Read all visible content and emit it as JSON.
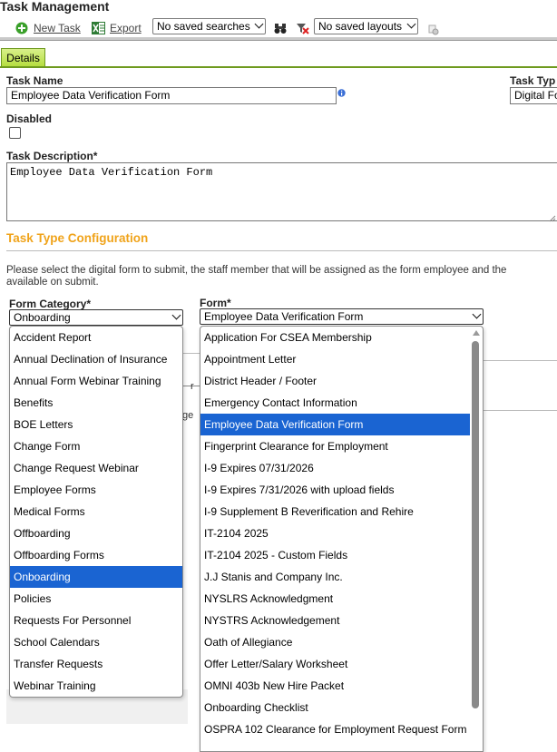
{
  "app": {
    "title": "Task Management"
  },
  "toolbar": {
    "new_task": "New Task",
    "export": "Export",
    "saved_searches": "No saved searches",
    "saved_layouts": "No saved layouts"
  },
  "tabs": [
    {
      "label": "Details"
    }
  ],
  "fields": {
    "task_name_label": "Task Name",
    "task_name_value": "Employee Data Verification Form",
    "task_type_label": "Task Typ",
    "task_type_value": "Digital Fo",
    "disabled_label": "Disabled",
    "description_label": "Task Description*",
    "description_value": "Employee Data Verification Form"
  },
  "config": {
    "title": "Task Type Configuration",
    "instructions_line1": "Please select the digital form to submit, the staff member that will be assigned as the form employee and the",
    "instructions_line2": "available on submit.",
    "form_category_label": "Form Category*",
    "form_category_value": "Onboarding",
    "form_label": "Form*",
    "form_value": "Employee Data Verification Form"
  },
  "background_fragments": {
    "r": "r",
    "ge": "ge"
  },
  "category_options": [
    "Accident Report",
    "Annual Declination of Insurance",
    "Annual Form Webinar Training",
    "Benefits",
    "BOE Letters",
    "Change Form",
    "Change Request Webinar",
    "Employee Forms",
    "Medical Forms",
    "Offboarding",
    "Offboarding Forms",
    "Onboarding",
    "Policies",
    "Requests For Personnel",
    "School Calendars",
    "Transfer Requests",
    "Webinar Training"
  ],
  "category_selected": "Onboarding",
  "form_options": [
    "Application For CSEA Membership",
    "Appointment Letter",
    "District Header / Footer",
    "Emergency Contact Information",
    "Employee Data Verification Form",
    "Fingerprint Clearance for Employment",
    "I-9 Expires 07/31/2026",
    "I-9 Expires 7/31/2026 with upload fields",
    "I-9 Supplement B Reverification and Rehire",
    "IT-2104 2025",
    "IT-2104 2025 - Custom Fields",
    "J.J Stanis and Company Inc.",
    "NYSLRS Acknowledgment",
    "NYSTRS Acknowledgement",
    "Oath of Allegiance",
    "Offer Letter/Salary Worksheet",
    "OMNI 403b New Hire Packet",
    "Onboarding Checklist",
    "OSPRA 102 Clearance for Employment Request Form"
  ],
  "form_selected": "Employee Data Verification Form",
  "colors": {
    "accent": "#f0a31a",
    "selection": "#1a64d2",
    "tab": "#b3dd3c"
  }
}
